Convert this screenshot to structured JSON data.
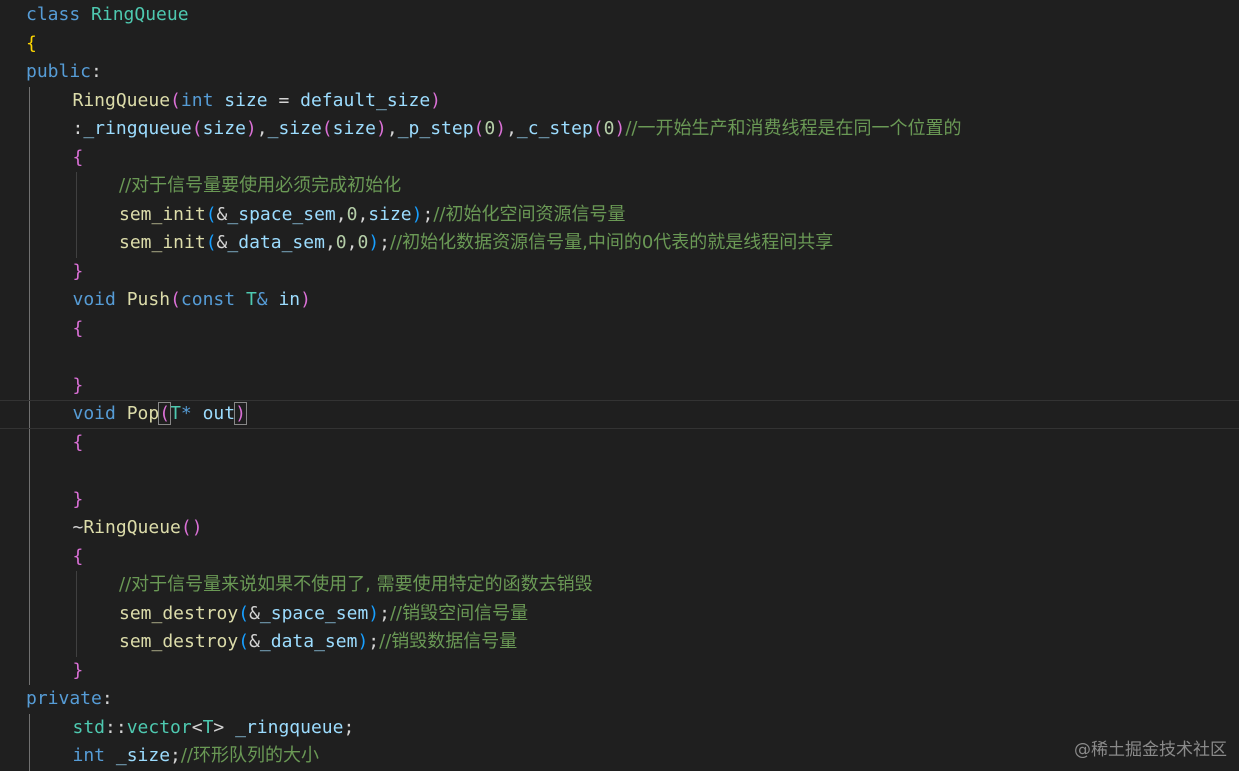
{
  "editor": {
    "language": "cpp",
    "watermark": "@稀土掘金技术社区",
    "lines": [
      {
        "indent": 0,
        "tokens": [
          [
            "kw",
            "class"
          ],
          [
            "op",
            " "
          ],
          [
            "cls",
            "RingQueue"
          ]
        ]
      },
      {
        "indent": 0,
        "tokens": [
          [
            "b1",
            "{"
          ]
        ]
      },
      {
        "indent": 0,
        "tokens": [
          [
            "kw",
            "public"
          ],
          [
            "op",
            ":"
          ]
        ]
      },
      {
        "indent": 1,
        "tokens": [
          [
            "fn",
            "RingQueue"
          ],
          [
            "b2",
            "("
          ],
          [
            "kw",
            "int"
          ],
          [
            "op",
            " "
          ],
          [
            "param",
            "size"
          ],
          [
            "op",
            " = "
          ],
          [
            "var",
            "default_size"
          ],
          [
            "b2",
            ")"
          ]
        ]
      },
      {
        "indent": 1,
        "tokens": [
          [
            "op",
            ":"
          ],
          [
            "var",
            "_ringqueue"
          ],
          [
            "b2",
            "("
          ],
          [
            "param",
            "size"
          ],
          [
            "b2",
            ")"
          ],
          [
            "op",
            ","
          ],
          [
            "var",
            "_size"
          ],
          [
            "b2",
            "("
          ],
          [
            "param",
            "size"
          ],
          [
            "b2",
            ")"
          ],
          [
            "op",
            ","
          ],
          [
            "var",
            "_p_step"
          ],
          [
            "b2",
            "("
          ],
          [
            "num",
            "0"
          ],
          [
            "b2",
            ")"
          ],
          [
            "op",
            ","
          ],
          [
            "var",
            "_c_step"
          ],
          [
            "b2",
            "("
          ],
          [
            "num",
            "0"
          ],
          [
            "b2",
            ")"
          ],
          [
            "cmt",
            "//一开始生产和消费线程是在同一个位置的"
          ]
        ]
      },
      {
        "indent": 1,
        "tokens": [
          [
            "b2",
            "{"
          ]
        ]
      },
      {
        "indent": 2,
        "tokens": [
          [
            "cmt",
            "//对于信号量要使用必须完成初始化"
          ]
        ]
      },
      {
        "indent": 2,
        "tokens": [
          [
            "fn",
            "sem_init"
          ],
          [
            "b3",
            "("
          ],
          [
            "op",
            "&"
          ],
          [
            "var",
            "_space_sem"
          ],
          [
            "op",
            ","
          ],
          [
            "num",
            "0"
          ],
          [
            "op",
            ","
          ],
          [
            "param",
            "size"
          ],
          [
            "b3",
            ")"
          ],
          [
            "op",
            ";"
          ],
          [
            "cmt",
            "//初始化空间资源信号量"
          ]
        ]
      },
      {
        "indent": 2,
        "tokens": [
          [
            "fn",
            "sem_init"
          ],
          [
            "b3",
            "("
          ],
          [
            "op",
            "&"
          ],
          [
            "var",
            "_data_sem"
          ],
          [
            "op",
            ","
          ],
          [
            "num",
            "0"
          ],
          [
            "op",
            ","
          ],
          [
            "num",
            "0"
          ],
          [
            "b3",
            ")"
          ],
          [
            "op",
            ";"
          ],
          [
            "cmt",
            "//初始化数据资源信号量,中间的0代表的就是线程间共享"
          ]
        ]
      },
      {
        "indent": 1,
        "tokens": [
          [
            "b2",
            "}"
          ]
        ]
      },
      {
        "indent": 1,
        "tokens": [
          [
            "kw",
            "void"
          ],
          [
            "op",
            " "
          ],
          [
            "fn",
            "Push"
          ],
          [
            "b2",
            "("
          ],
          [
            "kw",
            "const"
          ],
          [
            "op",
            " "
          ],
          [
            "type",
            "T"
          ],
          [
            "kw",
            "&"
          ],
          [
            "op",
            " "
          ],
          [
            "param",
            "in"
          ],
          [
            "b2",
            ")"
          ]
        ]
      },
      {
        "indent": 1,
        "tokens": [
          [
            "b2",
            "{"
          ]
        ]
      },
      {
        "indent": 1,
        "tokens": []
      },
      {
        "indent": 1,
        "tokens": [
          [
            "b2",
            "}"
          ]
        ]
      },
      {
        "indent": 1,
        "current": true,
        "tokens": [
          [
            "kw",
            "void"
          ],
          [
            "op",
            " "
          ],
          [
            "fn",
            "Pop"
          ],
          [
            "b2m",
            "("
          ],
          [
            "type",
            "T"
          ],
          [
            "kw",
            "*"
          ],
          [
            "op",
            " "
          ],
          [
            "param",
            "out"
          ],
          [
            "b2m",
            ")"
          ]
        ]
      },
      {
        "indent": 1,
        "tokens": [
          [
            "b2",
            "{"
          ]
        ]
      },
      {
        "indent": 1,
        "tokens": []
      },
      {
        "indent": 1,
        "tokens": [
          [
            "b2",
            "}"
          ]
        ]
      },
      {
        "indent": 1,
        "tokens": [
          [
            "op",
            "~"
          ],
          [
            "fn",
            "RingQueue"
          ],
          [
            "b2",
            "()"
          ]
        ]
      },
      {
        "indent": 1,
        "tokens": [
          [
            "b2",
            "{"
          ]
        ]
      },
      {
        "indent": 2,
        "tokens": [
          [
            "cmt",
            "//对于信号量来说如果不使用了, 需要使用特定的函数去销毁"
          ]
        ]
      },
      {
        "indent": 2,
        "tokens": [
          [
            "fn",
            "sem_destroy"
          ],
          [
            "b3",
            "("
          ],
          [
            "op",
            "&"
          ],
          [
            "var",
            "_space_sem"
          ],
          [
            "b3",
            ")"
          ],
          [
            "op",
            ";"
          ],
          [
            "cmt",
            "//销毁空间信号量"
          ]
        ]
      },
      {
        "indent": 2,
        "tokens": [
          [
            "fn",
            "sem_destroy"
          ],
          [
            "b3",
            "("
          ],
          [
            "op",
            "&"
          ],
          [
            "var",
            "_data_sem"
          ],
          [
            "b3",
            ")"
          ],
          [
            "op",
            ";"
          ],
          [
            "cmt",
            "//销毁数据信号量"
          ]
        ]
      },
      {
        "indent": 1,
        "tokens": [
          [
            "b2",
            "}"
          ]
        ]
      },
      {
        "indent": 0,
        "tokens": [
          [
            "kw",
            "private"
          ],
          [
            "op",
            ":"
          ]
        ]
      },
      {
        "indent": 1,
        "tokens": [
          [
            "ns",
            "std"
          ],
          [
            "op",
            "::"
          ],
          [
            "type",
            "vector"
          ],
          [
            "op",
            "<"
          ],
          [
            "type",
            "T"
          ],
          [
            "op",
            "> "
          ],
          [
            "var",
            "_ringqueue"
          ],
          [
            "op",
            ";"
          ]
        ]
      },
      {
        "indent": 1,
        "tokens": [
          [
            "kw",
            "int"
          ],
          [
            "op",
            " "
          ],
          [
            "var",
            "_size"
          ],
          [
            "op",
            ";"
          ],
          [
            "cmt",
            "//环形队列的大小"
          ]
        ]
      }
    ]
  }
}
